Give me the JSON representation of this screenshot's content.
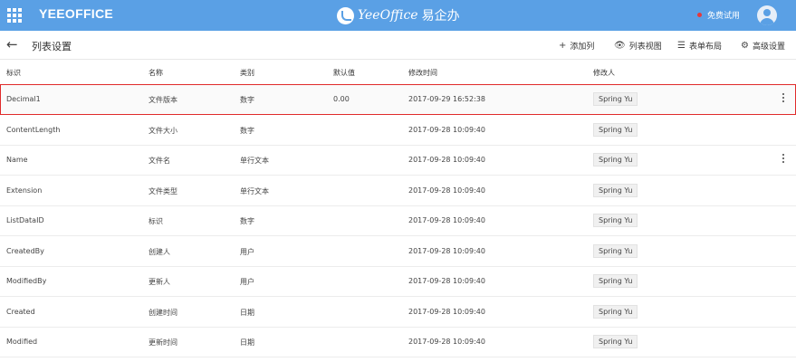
{
  "topbar": {
    "brand": "YEEOFFICE",
    "logo_text": "YeeOffice",
    "logo_cn": "易企办",
    "trial_label": "免费试用"
  },
  "toolbar": {
    "title": "列表设置",
    "add_column": "添加列",
    "list_view": "列表视图",
    "form_layout": "表单布局",
    "advanced": "高级设置"
  },
  "table": {
    "headers": [
      "标识",
      "名称",
      "类别",
      "默认值",
      "修改时间",
      "修改人"
    ],
    "rows": [
      {
        "id": "Decimal1",
        "name": "文件版本",
        "type": "数字",
        "default": "0.00",
        "modified": "2017-09-29 16:52:38",
        "by": "Spring Yu"
      },
      {
        "id": "ContentLength",
        "name": "文件大小",
        "type": "数字",
        "default": "",
        "modified": "2017-09-28 10:09:40",
        "by": "Spring Yu"
      },
      {
        "id": "Name",
        "name": "文件名",
        "type": "单行文本",
        "default": "",
        "modified": "2017-09-28 10:09:40",
        "by": "Spring Yu"
      },
      {
        "id": "Extension",
        "name": "文件类型",
        "type": "单行文本",
        "default": "",
        "modified": "2017-09-28 10:09:40",
        "by": "Spring Yu"
      },
      {
        "id": "ListDataID",
        "name": "标识",
        "type": "数字",
        "default": "",
        "modified": "2017-09-28 10:09:40",
        "by": "Spring Yu"
      },
      {
        "id": "CreatedBy",
        "name": "创建人",
        "type": "用户",
        "default": "",
        "modified": "2017-09-28 10:09:40",
        "by": "Spring Yu"
      },
      {
        "id": "ModifiedBy",
        "name": "更新人",
        "type": "用户",
        "default": "",
        "modified": "2017-09-28 10:09:40",
        "by": "Spring Yu"
      },
      {
        "id": "Created",
        "name": "创建时间",
        "type": "日期",
        "default": "",
        "modified": "2017-09-28 10:09:40",
        "by": "Spring Yu"
      },
      {
        "id": "Modified",
        "name": "更新时间",
        "type": "日期",
        "default": "",
        "modified": "2017-09-28 10:09:40",
        "by": "Spring Yu"
      }
    ]
  },
  "colors": {
    "topbar": "#5aa0e5",
    "selection": "#e02b2b",
    "trial_dot": "#e5393c"
  }
}
